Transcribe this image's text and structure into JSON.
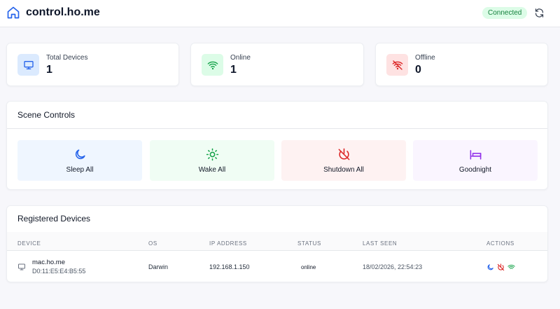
{
  "header": {
    "title": "control.ho.me",
    "status": "Connected",
    "home_icon": "home-icon",
    "refresh_icon": "refresh-icon"
  },
  "stats": [
    {
      "label": "Total Devices",
      "value": "1",
      "icon": "monitor-icon",
      "color": "#2563eb",
      "bg": "#dbeafe"
    },
    {
      "label": "Online",
      "value": "1",
      "icon": "wifi-icon",
      "color": "#16a34a",
      "bg": "#dcfce7"
    },
    {
      "label": "Offline",
      "value": "0",
      "icon": "wifi-off-icon",
      "color": "#dc2626",
      "bg": "#fee2e2"
    }
  ],
  "scenes": {
    "title": "Scene Controls",
    "items": [
      {
        "label": "Sleep All",
        "icon": "moon-icon",
        "color": "#2563eb",
        "bg": "#eff6ff"
      },
      {
        "label": "Wake All",
        "icon": "sun-icon",
        "color": "#16a34a",
        "bg": "#f0fdf4"
      },
      {
        "label": "Shutdown All",
        "icon": "power-off-icon",
        "color": "#dc2626",
        "bg": "#fef2f2"
      },
      {
        "label": "Goodnight",
        "icon": "bed-icon",
        "color": "#9333ea",
        "bg": "#faf5ff"
      }
    ]
  },
  "devices": {
    "title": "Registered Devices",
    "columns": [
      "DEVICE",
      "OS",
      "IP ADDRESS",
      "STATUS",
      "LAST SEEN",
      "ACTIONS"
    ],
    "rows": [
      {
        "name": "mac.ho.me",
        "mac": "D0:11:E5:E4:B5:55",
        "os": "Darwin",
        "ip": "192.168.1.150",
        "status": "online",
        "last_seen": "18/02/2026, 22:54:23",
        "actions": [
          "moon-icon",
          "power-off-icon",
          "wifi-icon"
        ]
      }
    ]
  }
}
